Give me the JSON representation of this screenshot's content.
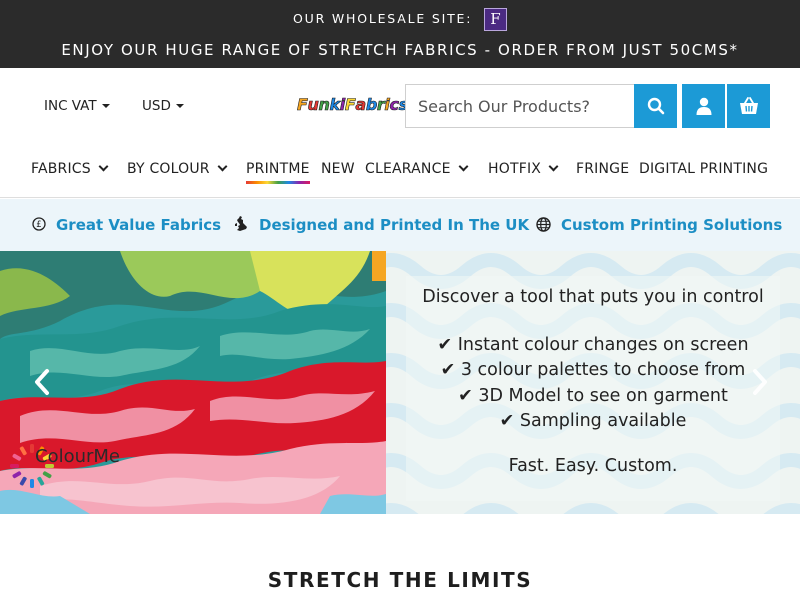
{
  "topbar": {
    "wholesale_label": "OUR WHOLESALE SITE:",
    "wholesale_logo_letter": "F",
    "promo": "ENJOY OUR HUGE RANGE OF STRETCH FABRICS - ORDER FROM JUST 50CMS*"
  },
  "header": {
    "vat_selector": "INC VAT",
    "currency_selector": "USD",
    "logo_text": "FunkiFabrics",
    "search_placeholder": "Search Our Products?",
    "icons": [
      "search-icon",
      "user-icon",
      "basket-icon"
    ],
    "accent_color": "#1c9ad6"
  },
  "nav": {
    "items": [
      {
        "label": "FABRICS",
        "has_dropdown": true
      },
      {
        "label": "BY COLOUR",
        "has_dropdown": true
      },
      {
        "label": "PRINTME",
        "has_dropdown": false
      },
      {
        "label": "NEW",
        "has_dropdown": false
      },
      {
        "label": "CLEARANCE",
        "has_dropdown": true
      },
      {
        "label": "HOTFIX",
        "has_dropdown": true
      },
      {
        "label": "FRINGE",
        "has_dropdown": false
      },
      {
        "label": "DIGITAL PRINTING",
        "has_dropdown": false
      }
    ]
  },
  "usp": {
    "items": [
      {
        "icon": "pound-coin-icon",
        "label": "Great Value Fabrics"
      },
      {
        "icon": "uk-map-icon",
        "label": "Designed and Printed In The UK"
      },
      {
        "icon": "globe-icon",
        "label": "Custom Printing Solutions"
      }
    ],
    "text_color": "#1c8ec4"
  },
  "hero": {
    "title": "Discover a tool that puts you in control",
    "checklist": [
      "✔ Instant colour changes on screen",
      "✔ 3 colour palettes to choose from",
      "✔ 3D Model to see on garment",
      "✔ Sampling available"
    ],
    "tagline": "Fast. Easy. Custom.",
    "brand_label": "ColourMe"
  },
  "section": {
    "title": "STRETCH THE LIMITS"
  }
}
